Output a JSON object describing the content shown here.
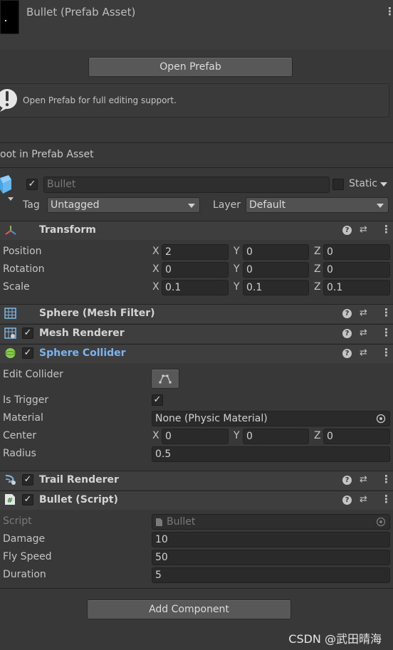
{
  "header": {
    "title": "Bullet (Prefab Asset)",
    "open_prefab_label": "Open Prefab",
    "help_text": "Open Prefab for full editing support.",
    "root_label": "oot in Prefab Asset"
  },
  "gameobject": {
    "active": true,
    "name": "Bullet",
    "static_label": "Static",
    "static": false,
    "tag_label": "Tag",
    "tag_value": "Untagged",
    "layer_label": "Layer",
    "layer_value": "Default"
  },
  "transform": {
    "title": "Transform",
    "rows": [
      {
        "label": "Position",
        "x": "2",
        "y": "0",
        "z": "0"
      },
      {
        "label": "Rotation",
        "x": "0",
        "y": "0",
        "z": "0"
      },
      {
        "label": "Scale",
        "x": "0.1",
        "y": "0.1",
        "z": "0.1"
      }
    ]
  },
  "components": {
    "mesh_filter": "Sphere (Mesh Filter)",
    "mesh_renderer": "Mesh Renderer",
    "sphere_collider": "Sphere Collider",
    "trail_renderer": "Trail Renderer",
    "bullet_script": "Bullet (Script)"
  },
  "sphere_collider": {
    "edit_collider_label": "Edit Collider",
    "is_trigger_label": "Is Trigger",
    "is_trigger": true,
    "material_label": "Material",
    "material_value": "None (Physic Material)",
    "center_label": "Center",
    "center": {
      "x": "0",
      "y": "0",
      "z": "0"
    },
    "radius_label": "Radius",
    "radius": "0.5"
  },
  "bullet_script": {
    "script_label": "Script",
    "script_value": "Bullet",
    "damage_label": "Damage",
    "damage": "10",
    "fly_speed_label": "Fly Speed",
    "fly_speed": "50",
    "duration_label": "Duration",
    "duration": "5"
  },
  "axes": {
    "x": "X",
    "y": "Y",
    "z": "Z"
  },
  "add_component_label": "Add Component",
  "watermark": "CSDN @武田晴海",
  "colors": {
    "background": "#383838",
    "field": "#2a2a2a",
    "button": "#585858",
    "link_blue": "#7cb4f0"
  }
}
